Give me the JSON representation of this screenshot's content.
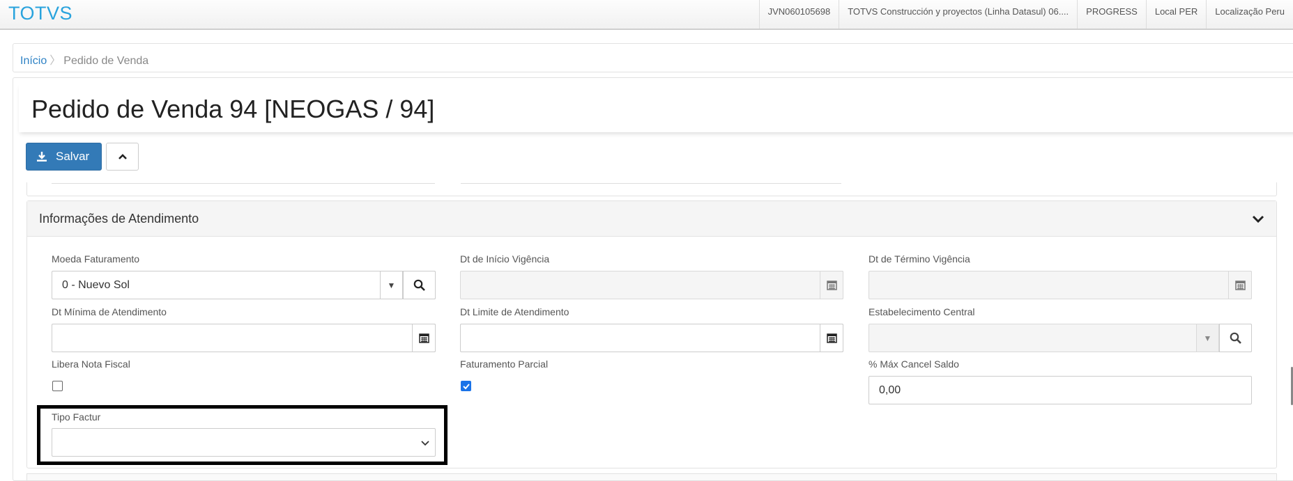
{
  "brand": "TOTVS",
  "topnav": [
    "JVN060105698",
    "TOTVS Construcción y proyectos (Linha Datasul) 06....",
    "PROGRESS",
    "Local PER",
    "Localização Peru"
  ],
  "breadcrumb": {
    "home": "Início",
    "separator": "〉",
    "current": "Pedido de Venda"
  },
  "page": {
    "title": "Pedido de Venda 94 [NEOGAS / 94]"
  },
  "toolbar": {
    "save_label": "Salvar"
  },
  "section": {
    "title": "Informações de Atendimento",
    "fields": {
      "moeda": {
        "label": "Moeda Faturamento",
        "value": "0 - Nuevo Sol"
      },
      "dt_inicio": {
        "label": "Dt de Início Vigência",
        "value": ""
      },
      "dt_termino": {
        "label": "Dt de Término Vigência",
        "value": ""
      },
      "dt_minima": {
        "label": "Dt Mínima de Atendimento",
        "value": ""
      },
      "dt_limite": {
        "label": "Dt Limite de Atendimento",
        "value": ""
      },
      "estab": {
        "label": "Estabelecimento Central",
        "value": ""
      },
      "libera_nf": {
        "label": "Libera Nota Fiscal",
        "checked": false
      },
      "fat_parcial": {
        "label": "Faturamento Parcial",
        "checked": true
      },
      "max_cancel": {
        "label": "% Máx Cancel Saldo",
        "value": "0,00"
      },
      "tipo_factur": {
        "label": "Tipo Factur",
        "value": ""
      }
    }
  },
  "colors": {
    "brand": "#29a3dd",
    "primary": "#337ab7",
    "link": "#2e82c5",
    "checkbox": "#1a73e8"
  }
}
